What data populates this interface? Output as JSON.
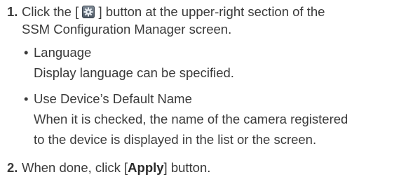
{
  "steps": [
    {
      "number": "1.",
      "text_before_icon": "Click the [ ",
      "icon": "settings-gear-icon",
      "text_after_icon": " ] button at the upper-right section of the",
      "line2": "SSM Configuration Manager screen."
    },
    {
      "number": "2.",
      "text_before": "When done, click [",
      "bold": "Apply",
      "text_after": "] button."
    }
  ],
  "options": [
    {
      "bullet": "•",
      "title": "Language",
      "description": [
        "Display language can be specified."
      ]
    },
    {
      "bullet": "•",
      "title": "Use Device’s Default Name",
      "description": [
        "When it is checked, the name of the camera registered",
        "to the device is displayed in the list or the screen."
      ]
    }
  ]
}
